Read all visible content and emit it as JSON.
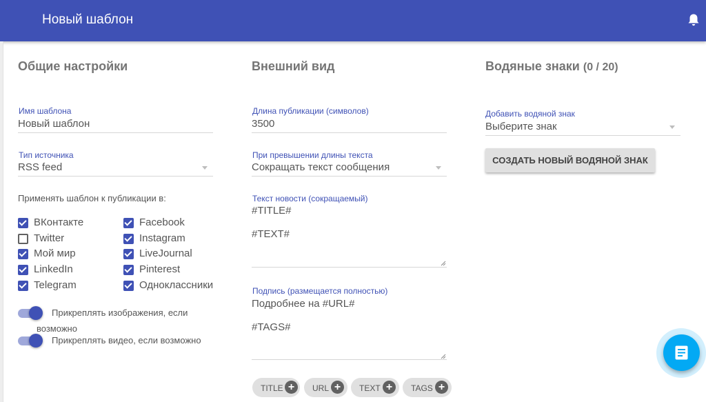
{
  "appbar": {
    "title": "Новый шаблон",
    "notifications_icon": "bell-icon",
    "color": "#3f51b5"
  },
  "general": {
    "title": "Общие настройки",
    "template_name": {
      "label": "Имя шаблона",
      "value": "Новый шаблон"
    },
    "source_type": {
      "label": "Тип источника",
      "value": "RSS feed"
    },
    "apply_label": "Применять шаблон к публикации в:",
    "networks": [
      {
        "label": "ВКонтакте",
        "checked": true
      },
      {
        "label": "Facebook",
        "checked": true
      },
      {
        "label": "Twitter",
        "checked": false
      },
      {
        "label": "Instagram",
        "checked": true
      },
      {
        "label": "Мой мир",
        "checked": true
      },
      {
        "label": "LiveJournal",
        "checked": true
      },
      {
        "label": "LinkedIn",
        "checked": true
      },
      {
        "label": "Pinterest",
        "checked": true
      },
      {
        "label": "Telegram",
        "checked": true
      },
      {
        "label": "Одноклассники",
        "checked": true
      }
    ],
    "toggles": [
      {
        "label": "Прикреплять изображения, если возможно",
        "on": true
      },
      {
        "label": "Прикреплять видео, если возможно",
        "on": true
      }
    ]
  },
  "appearance": {
    "title": "Внешний вид",
    "length": {
      "label": "Длина публикации (символов)",
      "value": "3500"
    },
    "overflow": {
      "label": "При превышении длины текста",
      "value": "Сокращать текст сообщения"
    },
    "news_text": {
      "label": "Текст новости (сокращаемый)",
      "value": "#TITLE#\n\n#TEXT#"
    },
    "signature": {
      "label": "Подпись (размещается полностью)",
      "value": "Подробнее на #URL#\n\n#TAGS#"
    },
    "chips": [
      "TITLE",
      "URL",
      "TEXT",
      "TAGS"
    ]
  },
  "watermarks": {
    "title": "Водяные знаки",
    "count": "(0 / 20)",
    "add": {
      "label": "Добавить водяной знак",
      "placeholder": "Выберите знак"
    },
    "create_button": "СОЗДАТЬ НОВЫЙ ВОДЯНОЙ ЗНАК"
  },
  "fab": {
    "icon": "message-icon",
    "color": "#03a9f4"
  }
}
